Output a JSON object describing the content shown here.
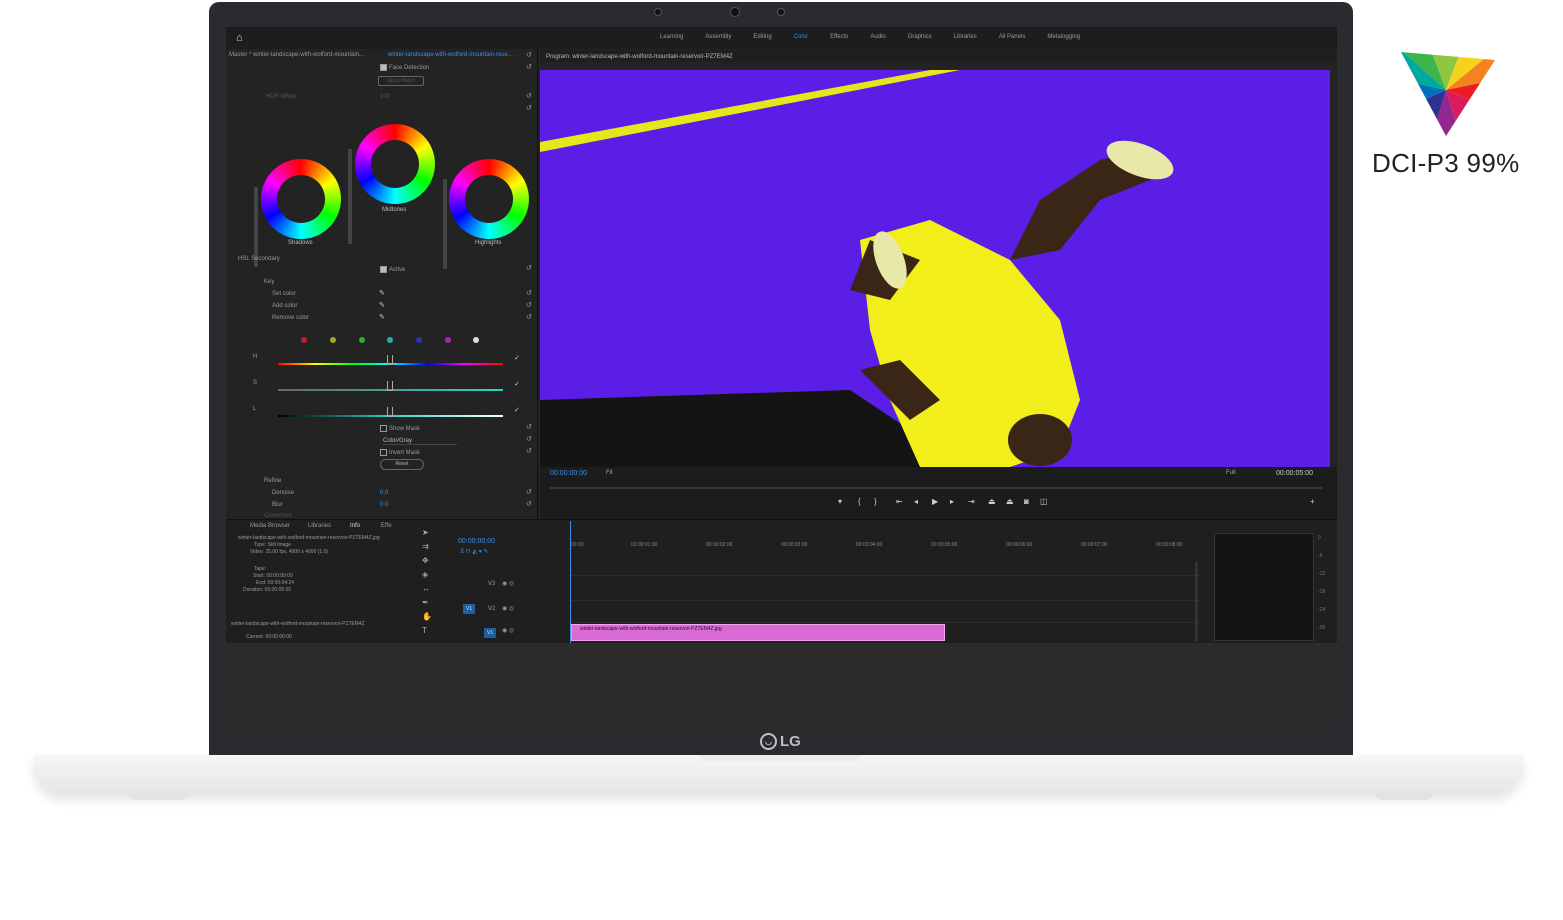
{
  "badge": {
    "text": "DCI-P3 99%"
  },
  "laptop": {
    "brand": "LG"
  },
  "premiere": {
    "workspaces": [
      "Learning",
      "Assembly",
      "Editing",
      "Color",
      "Effects",
      "Audio",
      "Graphics",
      "Libraries",
      "All Panels",
      "Metalogging"
    ],
    "active_workspace": "Color",
    "lumetri": {
      "master_label": "Master * winter-landscape-with-wolford-mountain...",
      "clip_label": "winter-landscape-with-wolford-mountain-rese...",
      "face_detection": "Face Detection",
      "apply_match": "Apply Match",
      "hdr_white": "HDR White",
      "hdr_white_value": "100",
      "wheels": [
        "Shadows",
        "Midtones",
        "Highlights"
      ],
      "hsl_secondary": "HSL Secondary",
      "active": "Active",
      "key": "Key",
      "set_color": "Set color",
      "add_color": "Add color",
      "remove_color": "Remove color",
      "h": "H",
      "s": "S",
      "l": "L",
      "show_mask": "Show Mask",
      "mask_mode": "Color/Gray",
      "invert_mask": "Invert Mask",
      "reset": "Reset",
      "refine": "Refine",
      "denoise": "Denoise",
      "denoise_value": "0.0",
      "blur": "Blur",
      "blur_value": "0.0",
      "correction": "Correction"
    },
    "program": {
      "title": "Program: winter-landscape-with-wolford-mountain-reservoir-PZ7EM4Z",
      "timecode_in": "00:00:00:00",
      "fit": "Fit",
      "full": "Full",
      "timecode_out": "00:00:05:00"
    },
    "bottom_tabs": [
      "Media Browser",
      "Libraries",
      "Info",
      "Effe"
    ],
    "info": {
      "filename": "winter-landscape-with-wolford-mountain-reservoir-PZ7EM4Z.jpg",
      "type": "Type: Still Image",
      "video": "Video: 25.00 fps, 4000 x 4000 (1.0)",
      "tape": "Tape:",
      "start": "Start: 00:00:00:00",
      "end": "End: 00:00:04:24",
      "duration": "Duration: 00:00:05:00",
      "filename2": "winter-landscape-with-wolford-mountain-reservoir-PZ7EM4Z",
      "current": "Current: 00:00:00:00"
    },
    "timeline": {
      "timecode": "00:00:00:00",
      "ruler": [
        "00:00",
        "00:00:01:00",
        "00:00:02:00",
        "00:00:03:00",
        "00:00:04:00",
        "00:00:05:00",
        "00:00:06:00",
        "00:00:07:00",
        "00:00:08:00"
      ],
      "tracks": [
        "V3",
        "V2",
        "V1"
      ],
      "clip_name": "winter-landscape-with-wolford-mountain-reservoir-PZ7EM4Z.jpg",
      "meter_labels": [
        "0",
        "-6",
        "-12",
        "-18",
        "-24",
        "-30"
      ]
    },
    "colors": {
      "accent": "#2d8ceb",
      "clip": "#d96ad6",
      "monitor_bg": "#5a1ee6"
    }
  }
}
